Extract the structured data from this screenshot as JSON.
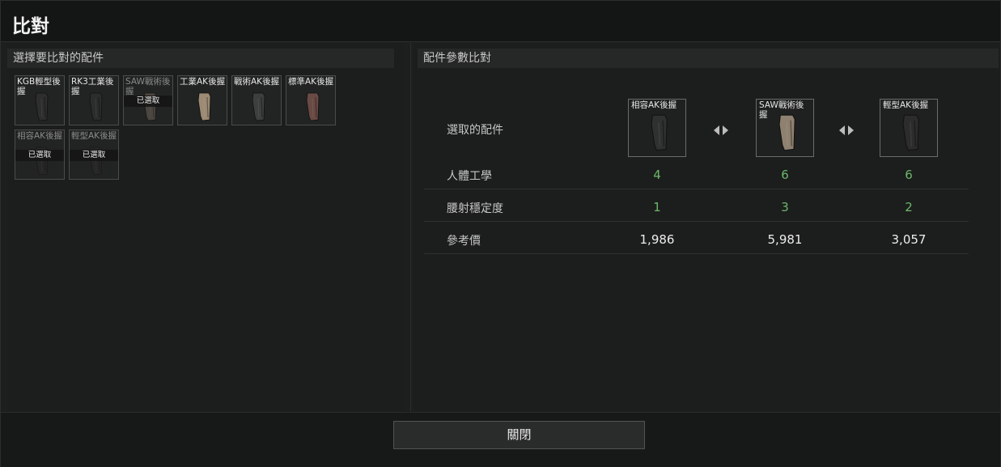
{
  "dialog": {
    "title": "比對",
    "close_label": "關閉"
  },
  "left": {
    "header": "選擇要比對的配件",
    "slots": [
      {
        "name": "KGB輕型後握",
        "selected": false,
        "color": "#2e2e2e",
        "selected_label": ""
      },
      {
        "name": "RK3工業後握",
        "selected": false,
        "color": "#2b2c2c",
        "selected_label": ""
      },
      {
        "name": "SAW戰術後握",
        "selected": true,
        "color": "#6d6257",
        "selected_label": "已選取"
      },
      {
        "name": "工業AK後握",
        "selected": false,
        "color": "#9c8a74",
        "selected_label": ""
      },
      {
        "name": "戰術AK後握",
        "selected": false,
        "color": "#3d3e3e",
        "selected_label": ""
      },
      {
        "name": "標準AK後握",
        "selected": false,
        "color": "#6a4a44",
        "selected_label": ""
      },
      {
        "name": "相容AK後握",
        "selected": true,
        "color": "#2a2a2a",
        "selected_label": "已選取"
      },
      {
        "name": "輕型AK後握",
        "selected": true,
        "color": "#2a2a2a",
        "selected_label": "已選取"
      }
    ]
  },
  "right": {
    "header": "配件參數比對",
    "selected_label": "選取的配件",
    "items": [
      {
        "name": "相容AK後握",
        "color": "#2f3030"
      },
      {
        "name": "SAW戰術後握",
        "color": "#8f8170"
      },
      {
        "name": "輕型AK後握",
        "color": "#2c2c2c"
      }
    ],
    "rows": [
      {
        "label": "人體工學",
        "values": [
          "4",
          "6",
          "6"
        ],
        "style": "green"
      },
      {
        "label": "腰射穩定度",
        "values": [
          "1",
          "3",
          "2"
        ],
        "style": "green"
      },
      {
        "label": "參考價",
        "values": [
          "1,986",
          "5,981",
          "3,057"
        ],
        "style": "white"
      }
    ]
  },
  "colors": {
    "accent_green": "#6bb86b",
    "background": "#1d1e1e"
  },
  "icons": {
    "compare_arrows": "left-right-arrows-icon",
    "grip": "pistol-grip-icon"
  }
}
